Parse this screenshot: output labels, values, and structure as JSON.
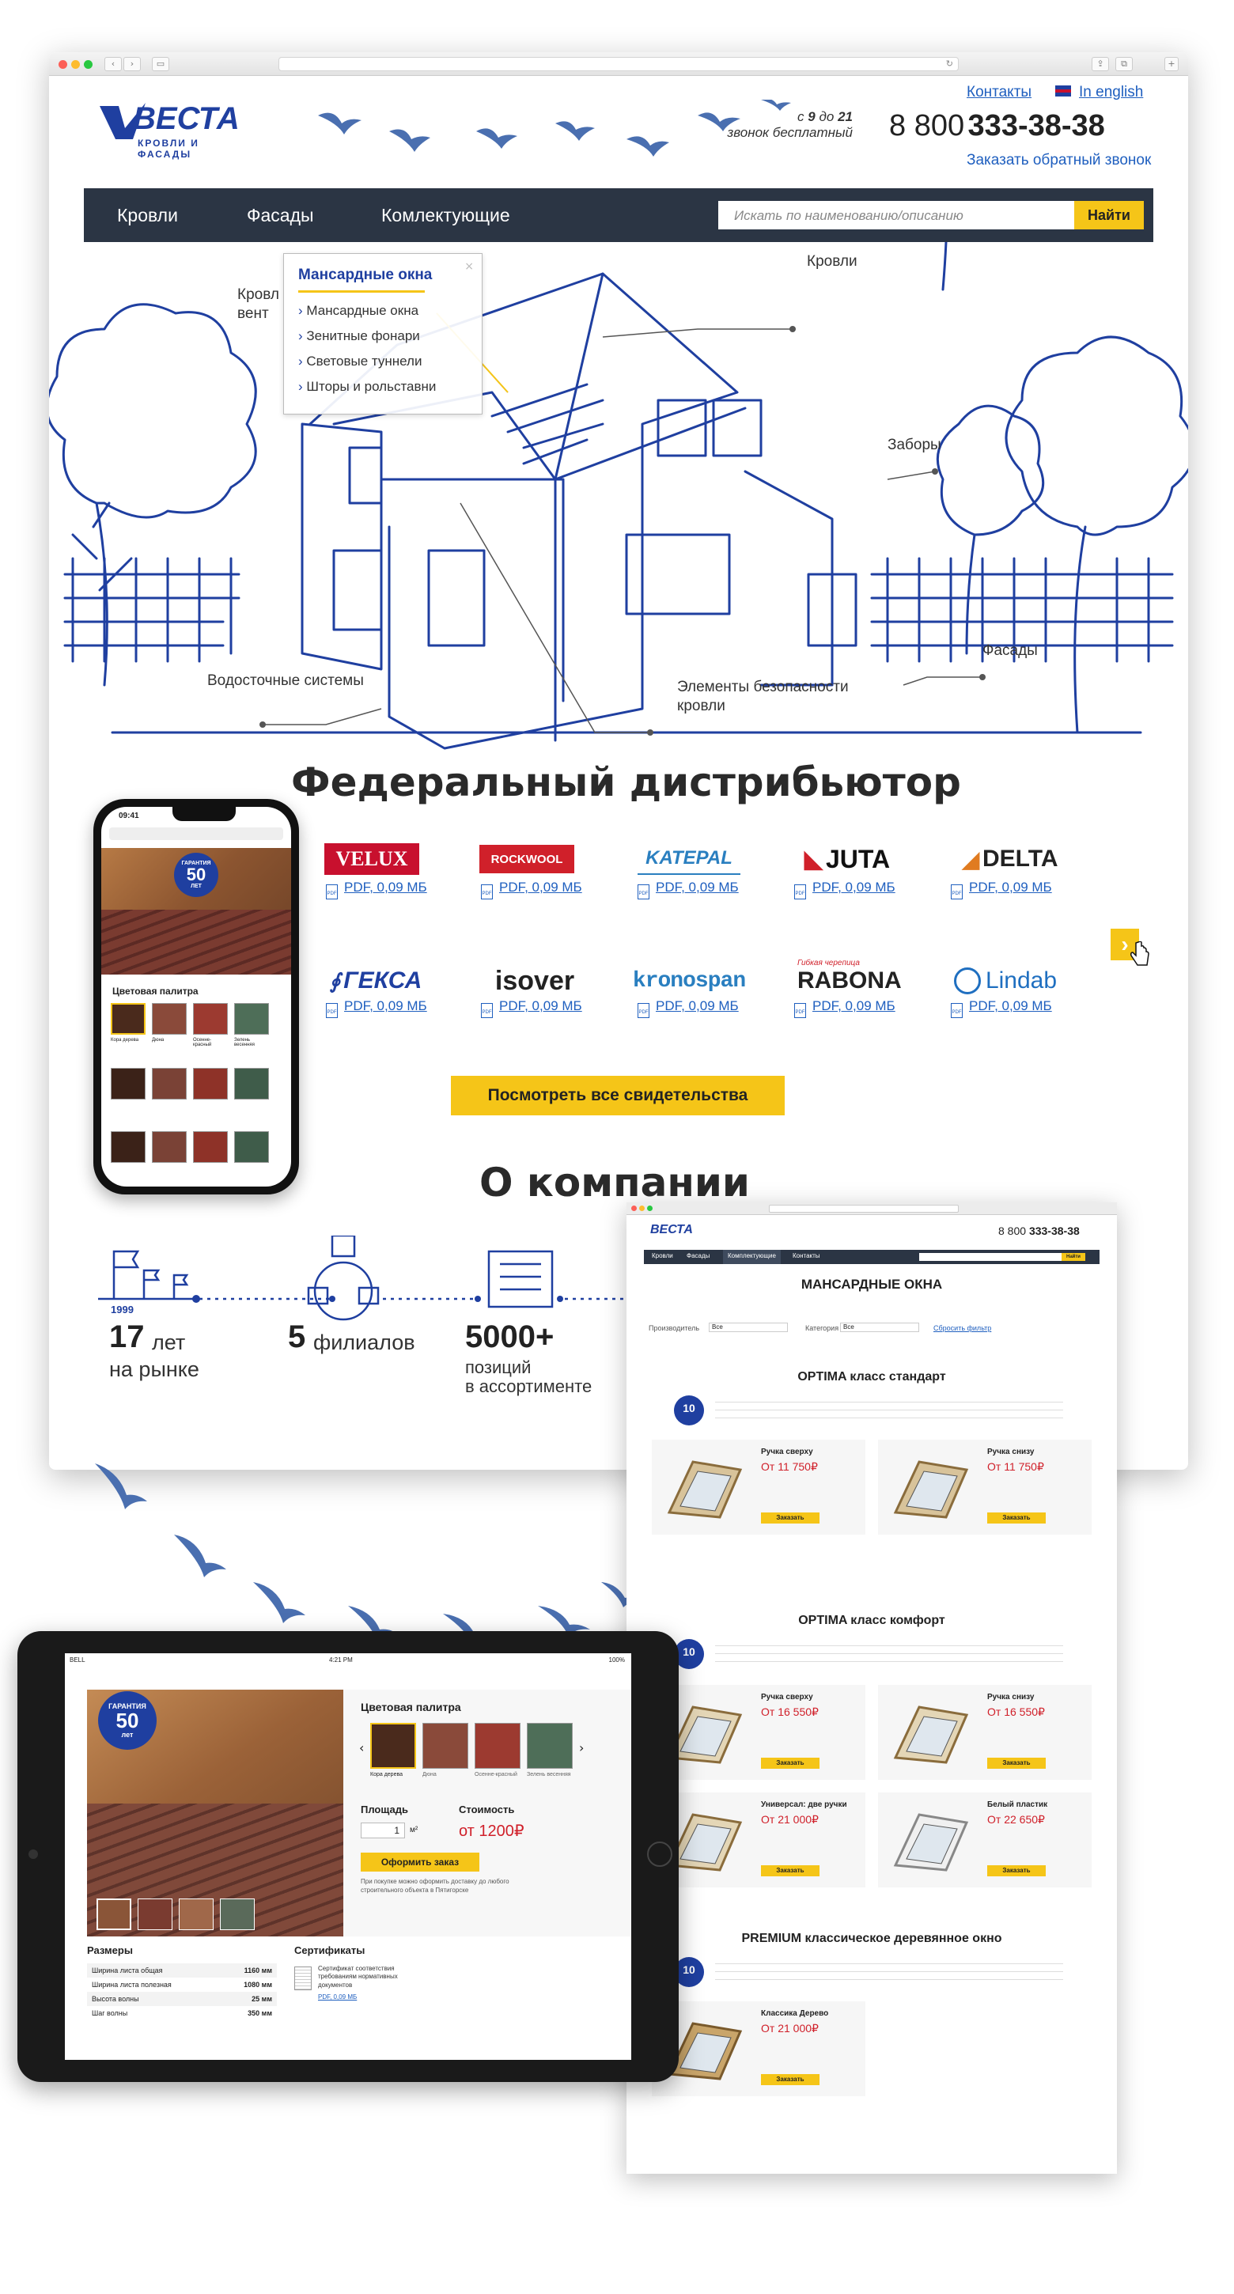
{
  "header": {
    "logo_name": "ВЕСТА",
    "logo_tagline": "КРОВЛИ И ФАСАДЫ",
    "contacts_link": "Контакты",
    "lang_link": "In english",
    "hours_prefix": "с",
    "hours_from": "9",
    "hours_mid": "до",
    "hours_to": "21",
    "call_free": "звонок бесплатный",
    "phone_prefix": "8 800",
    "phone_main": "333-38-38",
    "callback_link": "Заказать обратный звонок"
  },
  "nav": {
    "items": [
      "Кровли",
      "Фасады",
      "Комлектующие"
    ],
    "search_placeholder": "Искать по наименованию/описанию",
    "search_button": "Найти"
  },
  "dropdown": {
    "title": "Мансардные окна",
    "items": [
      "Мансардные окна",
      "Зенитные фонари",
      "Световые туннели",
      "Шторы и рольставни"
    ]
  },
  "house_labels": {
    "roofs": "Кровли",
    "roofs_vent_1": "Кровл",
    "roofs_vent_2": "вент",
    "fences": "Заборы",
    "facades": "Фасады",
    "drainage": "Водосточные системы",
    "safety_1": "Элементы безопасности",
    "safety_2": "кровли"
  },
  "distributor": {
    "title": "Федеральный дистрибьютор",
    "brands": [
      "VELUX",
      "ROCKWOOL",
      "KATEPAL",
      "JUTA",
      "DELTA",
      "ГЕКСА",
      "ISOVER",
      "kronospan",
      "RABONA",
      "Lindab"
    ],
    "rabona_sub": "Гибкая черепица",
    "pdf_label": "PDF, 0,09 МБ",
    "next_arrow": "›",
    "all_certificates_button": "Посмотреть все свидетельства"
  },
  "about": {
    "title": "О компании",
    "year": "1999",
    "stats": [
      {
        "num": "17",
        "unit": "лет",
        "line2": "на рынке"
      },
      {
        "num": "5",
        "unit": "филиалов",
        "line2": ""
      },
      {
        "num": "5000+",
        "unit": "позиций",
        "line2": "в ассортименте"
      }
    ]
  },
  "phone_mockup": {
    "time": "09:41",
    "guarantee_label": "ГАРАНТИЯ",
    "guarantee_years": "50",
    "guarantee_unit": "ЛЕТ",
    "palette_title": "Цветовая палитра",
    "swatch_labels": [
      "Кора дерева",
      "Дюна",
      "Осенне-красный",
      "Зелень весенняя"
    ]
  },
  "tablet_mockup": {
    "status_carrier": "BELL",
    "status_time": "4:21 PM",
    "status_battery": "100%",
    "guarantee_label": "ГАРАНТИЯ",
    "guarantee_years": "50",
    "guarantee_unit": "лет",
    "palette_title": "Цветовая палитра",
    "swatch_labels": [
      "Кора дерева",
      "Дюна",
      "Осенне-красный",
      "Зелень весенняя"
    ],
    "area_label": "Площадь",
    "area_value": "1",
    "area_unit": "м²",
    "cost_label": "Стоимость",
    "cost_value": "от 1200₽",
    "order_button": "Оформить заказ",
    "note": "При покупке можно оформить доставку до любого строительного объекта в Пятигорске",
    "sizes_title": "Размеры",
    "sizes": [
      {
        "name": "Ширина листа общая",
        "value": "1160 мм"
      },
      {
        "name": "Ширина листа полезная",
        "value": "1080 мм"
      },
      {
        "name": "Высота волны",
        "value": "25 мм"
      },
      {
        "name": "Шаг волны",
        "value": "350 мм"
      }
    ],
    "certs_title": "Сертификаты",
    "cert_text": "Сертификат соответствия требованиям нормативных документов",
    "cert_pdf": "PDF, 0,09 МБ"
  },
  "catalog_page": {
    "phone_prefix": "8 800",
    "phone_main": "333-38-38",
    "nav_items": [
      "Кровли",
      "Фасады",
      "Комплектующие",
      "Контакты"
    ],
    "search_button": "Найти",
    "title": "МАНСАРДНЫЕ ОКНА",
    "filter_maker": "Производитель",
    "filter_category": "Категория",
    "filter_all": "Все",
    "filter_reset": "Сбросить фильтр",
    "sections": [
      {
        "title": "OPTIMA класс стандарт",
        "badge": "10",
        "products": [
          {
            "name": "Ручка сверху",
            "price": "От 11 750₽",
            "order": "Заказать"
          },
          {
            "name": "Ручка снизу",
            "price": "От 11 750₽",
            "order": "Заказать"
          }
        ]
      },
      {
        "title": "OPTIMA класс комфорт",
        "badge": "10",
        "products": [
          {
            "name": "Ручка сверху",
            "price": "От 16 550₽",
            "order": "Заказать"
          },
          {
            "name": "Ручка снизу",
            "price": "От 16 550₽",
            "order": "Заказать"
          },
          {
            "name": "Универсал: две ручки",
            "price": "От 21 000₽",
            "order": "Заказать"
          },
          {
            "name": "Белый пластик",
            "price": "От 22 650₽",
            "order": "Заказать"
          }
        ]
      },
      {
        "title": "PREMIUM классическое деревянное окно",
        "badge": "10",
        "products": [
          {
            "name": "Классика Дерево",
            "price": "От 21 000₽",
            "order": "Заказать"
          }
        ]
      }
    ]
  },
  "colors": {
    "brand_blue": "#1f3fa0",
    "nav_dark": "#2b3544",
    "accent_yellow": "#f5c518",
    "price_red": "#d0202a"
  }
}
